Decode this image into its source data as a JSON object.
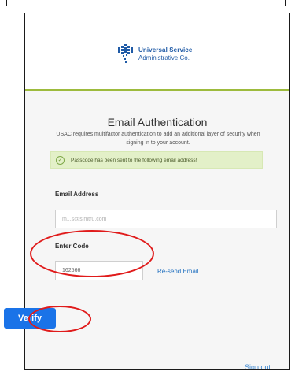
{
  "header": {
    "logo_line1": "Universal Service",
    "logo_line2": "Administrative Co."
  },
  "page": {
    "title": "Email Authentication",
    "subtitle": "USAC requires multifactor authentication to add an additional layer of security when signing in to your account.",
    "alert_message": "Passcode has been sent to the following email address!"
  },
  "form": {
    "email_label": "Email Address",
    "email_value": "m...s@simtru.com",
    "code_label": "Enter Code",
    "code_value": "162566",
    "resend_label": "Re-send Email",
    "verify_label": "Verify"
  },
  "footer": {
    "signout_label": "Sign out"
  },
  "colors": {
    "accent_green": "#9dbb3d",
    "button_blue": "#1a73e8",
    "annotation_red": "#e01b1b",
    "link_blue": "#1f6fbf"
  },
  "icons": {
    "logo": "usac-logo-icon",
    "alert": "check-circle-icon"
  }
}
